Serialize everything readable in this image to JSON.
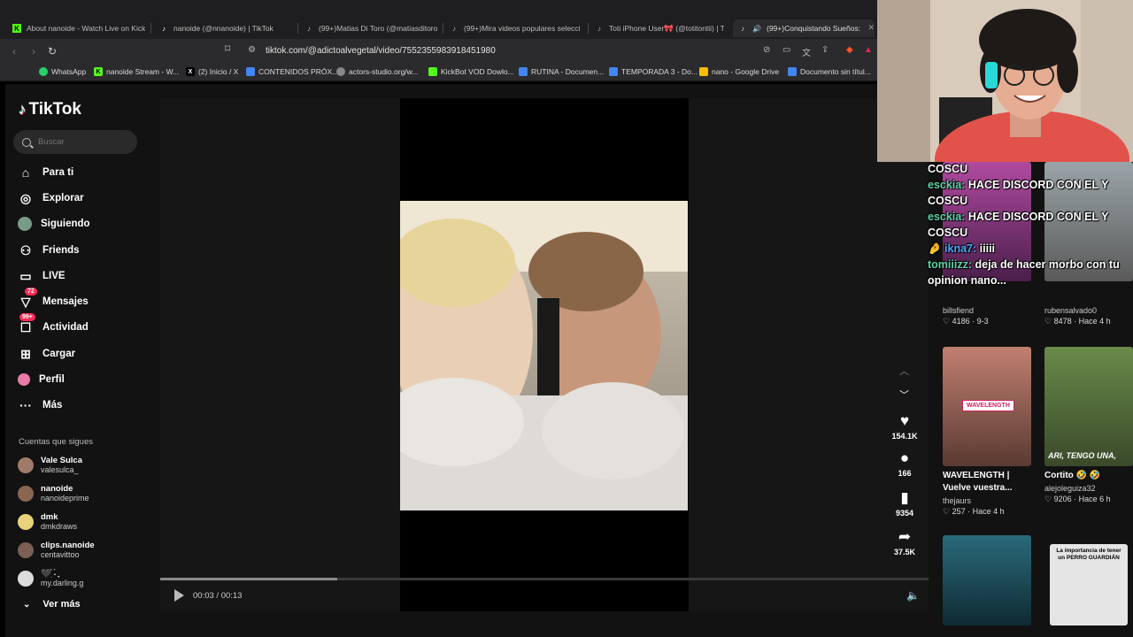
{
  "browser": {
    "tabs": [
      {
        "title": "About nanoide - Watch Live on Kick",
        "icon": "kick-icon",
        "active": false
      },
      {
        "title": "nanoide (@nnanoide) | TikTok",
        "icon": "tiktok-icon",
        "active": false
      },
      {
        "title": "(99+)Matias Di Toro (@matiasditoro",
        "icon": "tiktok-icon",
        "active": false
      },
      {
        "title": "(99+)Mira videos populares seleccio",
        "icon": "tiktok-icon",
        "active": false
      },
      {
        "title": "Toti iPhone User🎀 (@totitontii) | Tik",
        "icon": "tiktok-icon",
        "active": false
      },
      {
        "title": "(99+)Conquistando Sueños:",
        "icon": "tiktok-icon",
        "active": true
      }
    ],
    "url": "tiktok.com/@adictoalvegetal/video/7552355983918451980",
    "bookmarks": [
      {
        "label": "WhatsApp",
        "icon": "whatsapp-icon",
        "color": "#25d366"
      },
      {
        "label": "nanoide Stream - W...",
        "icon": "kick-icon",
        "color": "#53fc18"
      },
      {
        "label": "(2) Inicio / X",
        "icon": "x-icon",
        "color": "#000000"
      },
      {
        "label": "CONTENIDOS PRÓX...",
        "icon": "doc-icon",
        "color": "#4285f4"
      },
      {
        "label": "actors-studio.org/w...",
        "icon": "globe-icon",
        "color": "#888888"
      },
      {
        "label": "KickBot VOD Dowlo...",
        "icon": "puzzle-icon",
        "color": "#53fc18"
      },
      {
        "label": "RUTINA - Documen...",
        "icon": "doc-icon",
        "color": "#4285f4"
      },
      {
        "label": "TEMPORADA 3 - Do...",
        "icon": "doc-icon",
        "color": "#4285f4"
      },
      {
        "label": "nano - Google Drive",
        "icon": "drive-icon",
        "color": "#fbbc04"
      },
      {
        "label": "Documento sin títul...",
        "icon": "doc-icon",
        "color": "#4285f4"
      }
    ]
  },
  "tiktok": {
    "logo": "TikTok",
    "search_placeholder": "Buscar",
    "nav": [
      {
        "label": "Para ti",
        "icon": "home-icon",
        "badge": ""
      },
      {
        "label": "Explorar",
        "icon": "compass-icon",
        "badge": ""
      },
      {
        "label": "Siguiendo",
        "icon": "following-icon",
        "badge": ""
      },
      {
        "label": "Friends",
        "icon": "friends-icon",
        "badge": ""
      },
      {
        "label": "LIVE",
        "icon": "live-icon",
        "badge": ""
      },
      {
        "label": "Mensajes",
        "icon": "messages-icon",
        "badge": "72"
      },
      {
        "label": "Actividad",
        "icon": "activity-icon",
        "badge": "99+"
      },
      {
        "label": "Cargar",
        "icon": "upload-icon",
        "badge": ""
      },
      {
        "label": "Perfil",
        "icon": "profile-icon",
        "badge": ""
      },
      {
        "label": "Más",
        "icon": "more-icon",
        "badge": ""
      }
    ],
    "following_header": "Cuentas que sigues",
    "following": [
      {
        "name": "Vale Sulca",
        "handle": "valesulca_",
        "color": "#a07a6a"
      },
      {
        "name": "nanoide",
        "handle": "nanoideprime",
        "color": "#8a6650"
      },
      {
        "name": "dmk",
        "handle": "dmkdraws",
        "color": "#e8d27a"
      },
      {
        "name": "clips.nanoide",
        "handle": "centavittoo",
        "color": "#7a5f52"
      },
      {
        "name": "🖤ִ֗ ࣪˖ ִֶָ",
        "handle": "my.darling.g",
        "color": "#dddddd"
      }
    ],
    "see_more": "Ver más",
    "player": {
      "time": "00:03 / 00:13",
      "progress": 0.23
    },
    "actions": {
      "likes": "154.1K",
      "comments": "166",
      "saves": "9354",
      "shares": "37.5K"
    },
    "cards": [
      {
        "title": "",
        "user": "billsfiend",
        "meta": "4186 · 9-3",
        "thumb": "#6a2a66"
      },
      {
        "title": "",
        "user": "rubensalvado0",
        "meta": "8478 · Hace 4 h",
        "thumb": "#7a8a8e"
      },
      {
        "title": "WAVELENGTH | Vuelve vuestra...",
        "user": "thejaurs",
        "meta": "257 · Hace 4 h",
        "thumb": "#8a5a52",
        "overlay": "WAVELENGTH"
      },
      {
        "title": "Cortito 🤣 🤣",
        "user": "alejoleguiza32",
        "meta": "9206 · Hace 6 h",
        "thumb": "#4f6a3a",
        "overlay": "ARI, TENGO UNA,"
      },
      {
        "title": "",
        "user": "",
        "meta": "",
        "thumb": "#1f4a5a"
      },
      {
        "title": "",
        "user": "",
        "meta": "",
        "thumb": "#d8d8d8",
        "overlay": "La importancia de tener un PERRO GUARDIÁN"
      }
    ]
  },
  "chat": [
    {
      "user": "",
      "text": "COSCU"
    },
    {
      "user": "esckia:",
      "text": "HACE DISCORD CON EL Y COSCU"
    },
    {
      "user": "esckia:",
      "text": "HACE DISCORD CON EL Y COSCU"
    },
    {
      "user": "🤌 ikna7:",
      "text": "iiiii"
    },
    {
      "user": "tomiiizz:",
      "text": "deja de hacer morbo con tu opinion nano..."
    }
  ]
}
